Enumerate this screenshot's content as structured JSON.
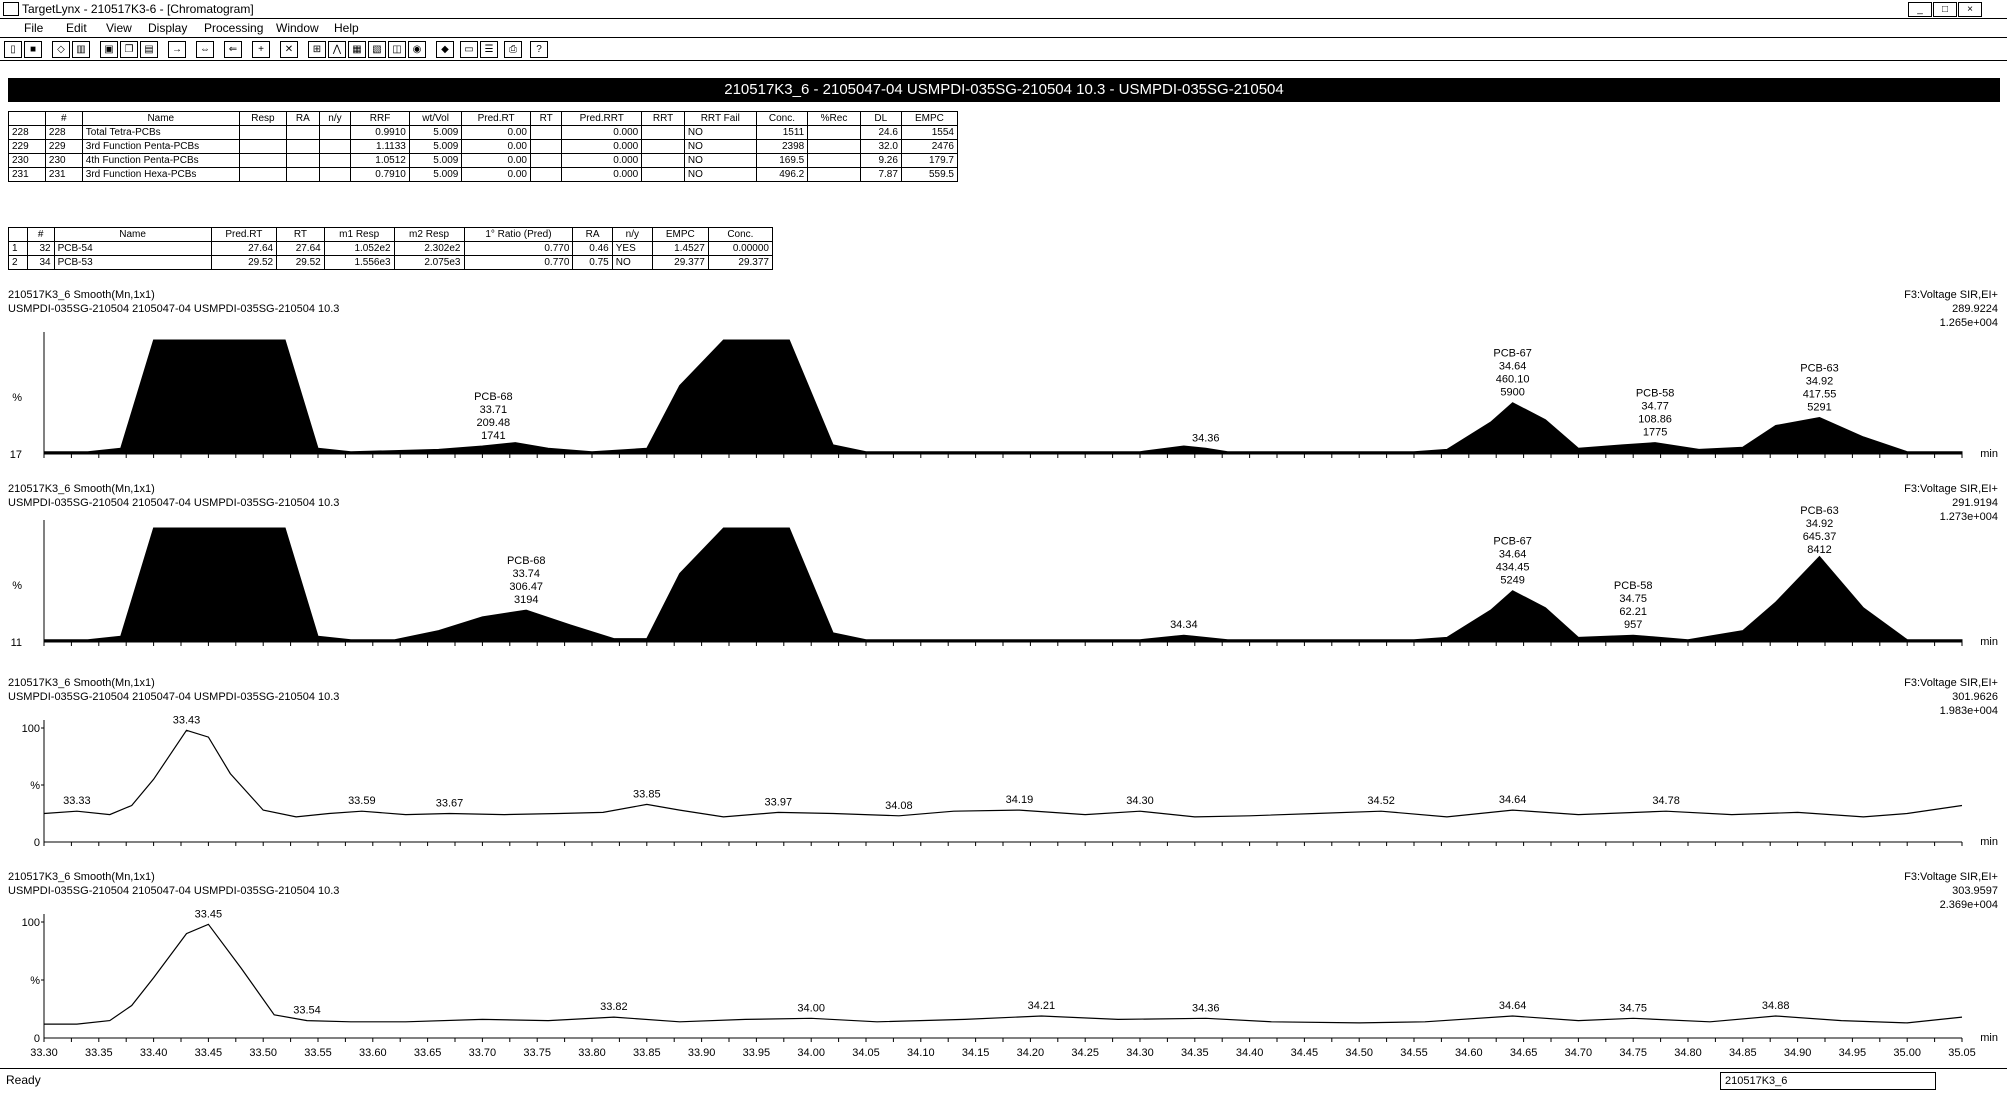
{
  "window": {
    "title": "TargetLynx - 210517K3-6 - [Chromatogram]",
    "buttons": [
      "_",
      "□",
      "×"
    ]
  },
  "menu": [
    "File",
    "Edit",
    "View",
    "Display",
    "Processing",
    "Window",
    "Help"
  ],
  "toolbar_icons": [
    "new-file-icon",
    "save-icon",
    "print-preview-icon",
    "chart-icon",
    "window-icon",
    "copy-icon",
    "paste-icon",
    "arrow-right-icon",
    "arrow-pair-icon",
    "arrow-left-icon",
    "plus-range-icon",
    "close-x-icon",
    "zoom-icon",
    "peak-icon",
    "table-icon",
    "report-icon",
    "refresh-icon",
    "record-icon",
    "color-icon",
    "grid-icon",
    "list-icon",
    "printer-icon",
    "help-icon"
  ],
  "sample_header": "210517K3_6 - 2105047-04 USMPDI-035SG-210504 10.3 - USMPDI-035SG-210504",
  "compound_table": {
    "columns": [
      "#",
      "Name",
      "Resp",
      "RA",
      "n/y",
      "RRF",
      "wt/Vol",
      "Pred.RT",
      "RT",
      "Pred.RRT",
      "RRT",
      "RRT Fail",
      "Conc.",
      "%Rec",
      "DL",
      "EMPC"
    ],
    "rows": [
      {
        "idx": "228",
        "num": "228",
        "name": "Total Tetra-PCBs",
        "resp": "",
        "ra": "",
        "ny": "",
        "rrf": "0.9910",
        "wtvol": "5.009",
        "predrt": "0.00",
        "rt": "",
        "predrrt": "0.000",
        "rrt": "",
        "fail": "NO",
        "conc": "1511",
        "rec": "",
        "dl": "24.6",
        "empc": "1554"
      },
      {
        "idx": "229",
        "num": "229",
        "name": "3rd Function Penta-PCBs",
        "resp": "",
        "ra": "",
        "ny": "",
        "rrf": "1.1133",
        "wtvol": "5.009",
        "predrt": "0.00",
        "rt": "",
        "predrrt": "0.000",
        "rrt": "",
        "fail": "NO",
        "conc": "2398",
        "rec": "",
        "dl": "32.0",
        "empc": "2476"
      },
      {
        "idx": "230",
        "num": "230",
        "name": "4th Function Penta-PCBs",
        "resp": "",
        "ra": "",
        "ny": "",
        "rrf": "1.0512",
        "wtvol": "5.009",
        "predrt": "0.00",
        "rt": "",
        "predrrt": "0.000",
        "rrt": "",
        "fail": "NO",
        "conc": "169.5",
        "rec": "",
        "dl": "9.26",
        "empc": "179.7"
      },
      {
        "idx": "231",
        "num": "231",
        "name": "3rd Function Hexa-PCBs",
        "resp": "",
        "ra": "",
        "ny": "",
        "rrf": "0.7910",
        "wtvol": "5.009",
        "predrt": "0.00",
        "rt": "",
        "predrrt": "0.000",
        "rrt": "",
        "fail": "NO",
        "conc": "496.2",
        "rec": "",
        "dl": "7.87",
        "empc": "559.5"
      }
    ]
  },
  "peak_table": {
    "columns": [
      "#",
      "Name",
      "Pred.RT",
      "RT",
      "m1 Resp",
      "m2 Resp",
      "1° Ratio (Pred)",
      "RA",
      "n/y",
      "EMPC",
      "Conc."
    ],
    "rows": [
      {
        "idx": "1",
        "num": "32",
        "name": "PCB-54",
        "predrt": "27.64",
        "rt": "27.64",
        "m1": "1.052e2",
        "m2": "2.302e2",
        "ratio": "0.770",
        "ra": "0.46",
        "ny": "YES",
        "empc": "1.4527",
        "conc": "0.00000"
      },
      {
        "idx": "2",
        "num": "34",
        "name": "PCB-53",
        "predrt": "29.52",
        "rt": "29.52",
        "m1": "1.556e3",
        "m2": "2.075e3",
        "ratio": "0.770",
        "ra": "0.75",
        "ny": "NO",
        "empc": "29.377",
        "conc": "29.377"
      }
    ]
  },
  "chart_data": [
    {
      "type": "line",
      "title": "210517K3_6 Smooth(Mn,1x1)",
      "subtitle": "USMPDI-035SG-210504 2105047-04 USMPDI-035SG-210504 10.3",
      "channel": "F3:Voltage SIR,EI+",
      "mass": "289.9224",
      "intensity": "1.265e+004",
      "ylabel": "%",
      "ymin_label": "17",
      "xlabel": "min",
      "xlim": [
        33.3,
        35.05
      ],
      "x": [
        33.3,
        33.34,
        33.37,
        33.4,
        33.42,
        33.52,
        33.55,
        33.58,
        33.62,
        33.66,
        33.7,
        33.73,
        33.76,
        33.8,
        33.85,
        33.88,
        33.92,
        33.98,
        34.02,
        34.05,
        34.1,
        34.2,
        34.3,
        34.34,
        34.36,
        34.38,
        34.45,
        34.55,
        34.58,
        34.62,
        34.64,
        34.67,
        34.7,
        34.74,
        34.77,
        34.81,
        34.85,
        34.88,
        34.92,
        34.96,
        35.0,
        35.05
      ],
      "y": [
        2,
        2,
        5,
        110,
        110,
        110,
        5,
        2,
        3,
        4,
        7,
        10,
        5,
        2,
        5,
        60,
        110,
        110,
        8,
        2,
        2,
        2,
        2,
        7,
        5,
        2,
        2,
        2,
        4,
        28,
        45,
        30,
        5,
        8,
        10,
        4,
        6,
        25,
        32,
        15,
        2,
        2
      ],
      "labels": [
        {
          "x": 33.71,
          "lines": [
            "PCB-68",
            "33.71",
            "209.48",
            "1741"
          ]
        },
        {
          "x": 34.36,
          "lines": [
            "34.36"
          ]
        },
        {
          "x": 34.64,
          "lines": [
            "PCB-67",
            "34.64",
            "460.10",
            "5900"
          ]
        },
        {
          "x": 34.77,
          "lines": [
            "PCB-58",
            "34.77",
            "108.86",
            "1775"
          ]
        },
        {
          "x": 34.92,
          "lines": [
            "PCB-63",
            "34.92",
            "417.55",
            "5291"
          ]
        }
      ]
    },
    {
      "type": "line",
      "title": "210517K3_6 Smooth(Mn,1x1)",
      "subtitle": "USMPDI-035SG-210504 2105047-04 USMPDI-035SG-210504 10.3",
      "channel": "F3:Voltage SIR,EI+",
      "mass": "291.9194",
      "intensity": "1.273e+004",
      "ylabel": "%",
      "ymin_label": "11",
      "xlabel": "min",
      "xlim": [
        33.3,
        35.05
      ],
      "x": [
        33.3,
        33.34,
        33.37,
        33.4,
        33.42,
        33.52,
        33.55,
        33.58,
        33.62,
        33.66,
        33.7,
        33.74,
        33.78,
        33.82,
        33.85,
        33.88,
        33.92,
        33.98,
        34.02,
        34.05,
        34.1,
        34.2,
        34.3,
        34.34,
        34.38,
        34.45,
        34.55,
        34.58,
        34.62,
        34.64,
        34.67,
        34.7,
        34.75,
        34.8,
        34.85,
        34.88,
        34.92,
        34.96,
        35.0,
        35.05
      ],
      "y": [
        2,
        2,
        5,
        110,
        110,
        110,
        5,
        2,
        2,
        10,
        22,
        28,
        15,
        3,
        3,
        60,
        110,
        110,
        8,
        2,
        2,
        2,
        2,
        6,
        2,
        2,
        2,
        4,
        28,
        45,
        30,
        4,
        6,
        2,
        10,
        35,
        75,
        30,
        2,
        2
      ],
      "labels": [
        {
          "x": 33.74,
          "lines": [
            "PCB-68",
            "33.74",
            "306.47",
            "3194"
          ]
        },
        {
          "x": 34.34,
          "lines": [
            "34.34"
          ]
        },
        {
          "x": 34.64,
          "lines": [
            "PCB-67",
            "34.64",
            "434.45",
            "5249"
          ]
        },
        {
          "x": 34.75,
          "lines": [
            "PCB-58",
            "34.75",
            "62.21",
            "957"
          ]
        },
        {
          "x": 34.92,
          "lines": [
            "PCB-63",
            "34.92",
            "645.37",
            "8412"
          ]
        }
      ]
    },
    {
      "type": "line",
      "title": "210517K3_6 Smooth(Mn,1x1)",
      "subtitle": "USMPDI-035SG-210504 2105047-04 USMPDI-035SG-210504 10.3",
      "channel": "F3:Voltage SIR,EI+",
      "mass": "301.9626",
      "intensity": "1.983e+004",
      "ylabel": "%",
      "yticks": [
        "100",
        "%",
        "0"
      ],
      "xlabel": "min",
      "xlim": [
        33.3,
        35.05
      ],
      "x": [
        33.3,
        33.33,
        33.36,
        33.38,
        33.4,
        33.43,
        33.45,
        33.47,
        33.5,
        33.53,
        33.56,
        33.59,
        33.63,
        33.67,
        33.72,
        33.77,
        33.81,
        33.85,
        33.88,
        33.92,
        33.97,
        34.02,
        34.08,
        34.13,
        34.19,
        34.25,
        34.3,
        34.35,
        34.4,
        34.46,
        34.52,
        34.58,
        34.64,
        34.7,
        34.78,
        34.84,
        34.9,
        34.96,
        35.0,
        35.05
      ],
      "y": [
        25,
        27,
        24,
        32,
        55,
        98,
        92,
        60,
        28,
        22,
        25,
        27,
        24,
        25,
        24,
        25,
        26,
        33,
        28,
        22,
        26,
        25,
        23,
        27,
        28,
        24,
        27,
        22,
        23,
        25,
        27,
        22,
        28,
        24,
        27,
        24,
        26,
        22,
        25,
        32
      ],
      "labels": [
        {
          "x": 33.33,
          "lines": [
            "33.33"
          ]
        },
        {
          "x": 33.43,
          "lines": [
            "33.43"
          ]
        },
        {
          "x": 33.59,
          "lines": [
            "33.59"
          ]
        },
        {
          "x": 33.67,
          "lines": [
            "33.67"
          ]
        },
        {
          "x": 33.85,
          "lines": [
            "33.85"
          ]
        },
        {
          "x": 33.97,
          "lines": [
            "33.97"
          ]
        },
        {
          "x": 34.08,
          "lines": [
            "34.08"
          ]
        },
        {
          "x": 34.19,
          "lines": [
            "34.19"
          ]
        },
        {
          "x": 34.3,
          "lines": [
            "34.30"
          ]
        },
        {
          "x": 34.52,
          "lines": [
            "34.52"
          ]
        },
        {
          "x": 34.64,
          "lines": [
            "34.64"
          ]
        },
        {
          "x": 34.78,
          "lines": [
            "34.78"
          ]
        }
      ]
    },
    {
      "type": "line",
      "title": "210517K3_6 Smooth(Mn,1x1)",
      "subtitle": "USMPDI-035SG-210504 2105047-04 USMPDI-035SG-210504 10.3",
      "channel": "F3:Voltage SIR,EI+",
      "mass": "303.9597",
      "intensity": "2.369e+004",
      "ylabel": "%",
      "yticks": [
        "100",
        "%",
        "0"
      ],
      "xlabel": "min",
      "xlim": [
        33.3,
        35.05
      ],
      "x": [
        33.3,
        33.33,
        33.36,
        33.38,
        33.4,
        33.43,
        33.45,
        33.48,
        33.51,
        33.54,
        33.58,
        33.63,
        33.7,
        33.76,
        33.82,
        33.88,
        33.94,
        34.0,
        34.06,
        34.14,
        34.21,
        34.28,
        34.36,
        34.42,
        34.5,
        34.56,
        34.64,
        34.7,
        34.75,
        34.82,
        34.88,
        34.94,
        35.0,
        35.05
      ],
      "y": [
        12,
        12,
        15,
        28,
        52,
        90,
        98,
        60,
        20,
        15,
        14,
        14,
        16,
        15,
        18,
        14,
        16,
        17,
        14,
        16,
        19,
        16,
        17,
        14,
        13,
        14,
        19,
        15,
        17,
        14,
        19,
        15,
        13,
        18
      ],
      "labels": [
        {
          "x": 33.45,
          "lines": [
            "33.45"
          ]
        },
        {
          "x": 33.54,
          "lines": [
            "33.54"
          ]
        },
        {
          "x": 33.82,
          "lines": [
            "33.82"
          ]
        },
        {
          "x": 34.0,
          "lines": [
            "34.00"
          ]
        },
        {
          "x": 34.21,
          "lines": [
            "34.21"
          ]
        },
        {
          "x": 34.36,
          "lines": [
            "34.36"
          ]
        },
        {
          "x": 34.64,
          "lines": [
            "34.64"
          ]
        },
        {
          "x": 34.75,
          "lines": [
            "34.75"
          ]
        },
        {
          "x": 34.88,
          "lines": [
            "34.88"
          ]
        }
      ],
      "xticks": [
        "33.30",
        "33.35",
        "33.40",
        "33.45",
        "33.50",
        "33.55",
        "33.60",
        "33.65",
        "33.70",
        "33.75",
        "33.80",
        "33.85",
        "33.90",
        "33.95",
        "34.00",
        "34.05",
        "34.10",
        "34.15",
        "34.20",
        "34.25",
        "34.30",
        "34.35",
        "34.40",
        "34.45",
        "34.50",
        "34.55",
        "34.60",
        "34.65",
        "34.70",
        "34.75",
        "34.80",
        "34.85",
        "34.90",
        "34.95",
        "35.00",
        "35.05"
      ]
    }
  ],
  "status": {
    "text": "Ready",
    "filename": "210517K3_6"
  }
}
